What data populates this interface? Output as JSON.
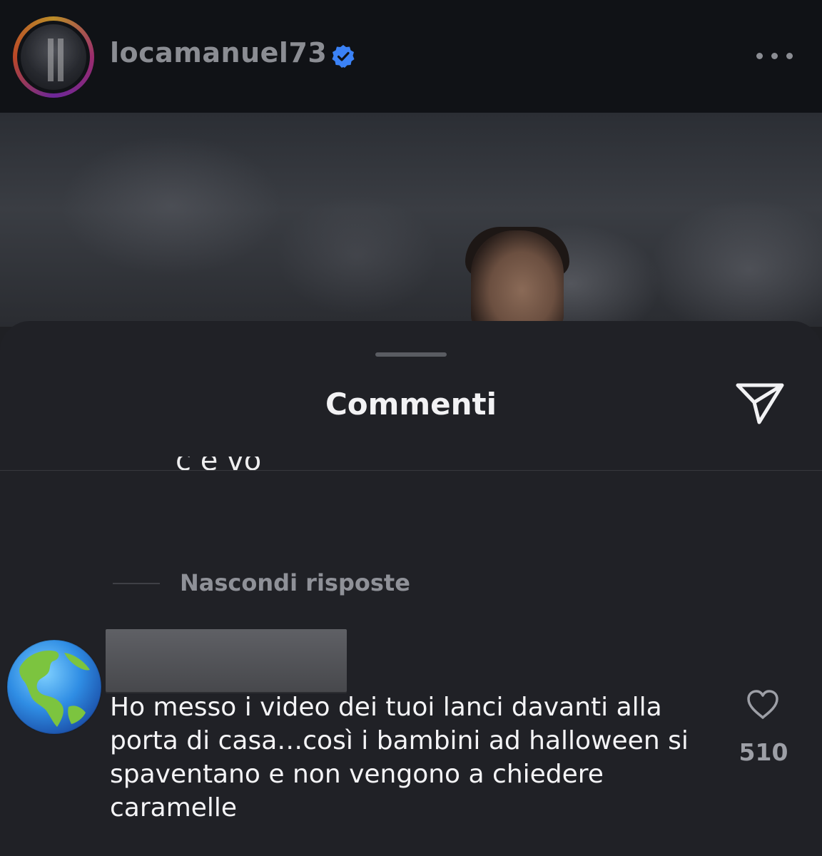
{
  "header": {
    "username": "locamanuel73",
    "verified_icon": "verified-badge-icon",
    "more_icon": "more-options-icon"
  },
  "sheet": {
    "title": "Commenti",
    "send_icon": "paper-plane-icon",
    "clipped_text": "c e vo",
    "hide_replies_label": "Nascondi risposte"
  },
  "comment": {
    "avatar_icon": "globe-americas-icon",
    "text": "Ho messo i video dei tuoi lanci davanti alla porta di casa…così i bambini ad halloween si spaventano e non vengono a chiedere caramelle",
    "like_icon": "heart-outline-icon",
    "like_count": "510"
  },
  "colors": {
    "header_bg": "#101216",
    "sheet_bg": "#202126",
    "verified_blue": "#3b82f6"
  }
}
